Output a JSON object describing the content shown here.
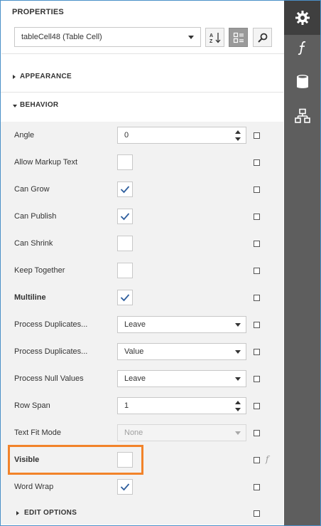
{
  "panel": {
    "title": "PROPERTIES",
    "selector_value": "tableCell48 (Table Cell)",
    "toolbar": [
      {
        "name": "sort-alphabetical-button",
        "icon": "sort-az-icon",
        "active": false
      },
      {
        "name": "categorized-view-button",
        "icon": "categories-icon",
        "active": true
      },
      {
        "name": "search-button",
        "icon": "search-icon",
        "active": false
      }
    ]
  },
  "sections": {
    "appearance": {
      "label": "APPEARANCE",
      "expanded": false
    },
    "behavior": {
      "label": "BEHAVIOR",
      "expanded": true
    },
    "edit_options": {
      "label": "EDIT OPTIONS",
      "expanded": false
    }
  },
  "properties": [
    {
      "label": "Angle",
      "editor": "spin",
      "value": "0",
      "bold": false
    },
    {
      "label": "Allow Markup Text",
      "editor": "check",
      "checked": false,
      "bold": false
    },
    {
      "label": "Can Grow",
      "editor": "check",
      "checked": true,
      "bold": false
    },
    {
      "label": "Can Publish",
      "editor": "check",
      "checked": true,
      "bold": false
    },
    {
      "label": "Can Shrink",
      "editor": "check",
      "checked": false,
      "bold": false
    },
    {
      "label": "Keep Together",
      "editor": "check",
      "checked": false,
      "bold": false
    },
    {
      "label": "Multiline",
      "editor": "check",
      "checked": true,
      "bold": true
    },
    {
      "label": "Process Duplicates...",
      "editor": "dropdown",
      "value": "Leave",
      "bold": false
    },
    {
      "label": "Process Duplicates...",
      "editor": "dropdown",
      "value": "Value",
      "bold": false
    },
    {
      "label": "Process Null Values",
      "editor": "dropdown",
      "value": "Leave",
      "bold": false
    },
    {
      "label": "Row Span",
      "editor": "spin",
      "value": "1",
      "bold": false
    },
    {
      "label": "Text Fit Mode",
      "editor": "dropdown",
      "value": "None",
      "disabled": true,
      "bold": false
    },
    {
      "label": "Visible",
      "editor": "check",
      "checked": false,
      "bold": true,
      "highlighted": true,
      "expression": true
    },
    {
      "label": "Word Wrap",
      "editor": "check",
      "checked": true,
      "bold": false
    }
  ],
  "sidebar": [
    {
      "name": "properties-tab",
      "icon": "gear-icon",
      "active": true
    },
    {
      "name": "expressions-tab",
      "icon": "function-icon",
      "active": false
    },
    {
      "name": "data-source-tab",
      "icon": "database-icon",
      "active": false
    },
    {
      "name": "report-explorer-tab",
      "icon": "hierarchy-icon",
      "active": false
    }
  ],
  "colors": {
    "highlight": "#f2832a",
    "check": "#2f5f9e",
    "sidebar": "#5e5e5e"
  },
  "expression_marker": "f"
}
